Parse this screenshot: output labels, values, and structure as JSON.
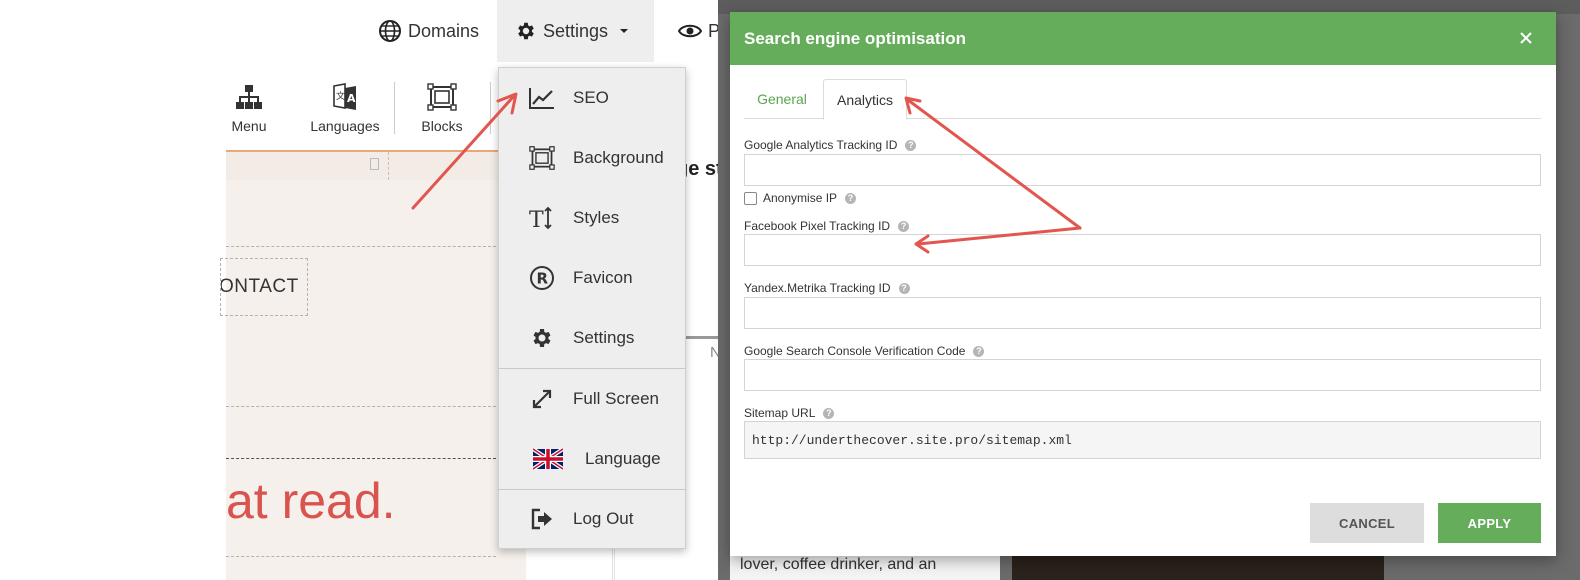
{
  "topnav": {
    "domains_label": "Domains",
    "settings_label": "Settings",
    "preview_label": "Pr"
  },
  "toolbar": {
    "menu_label": "Menu",
    "languages_label": "Languages",
    "blocks_label": "Blocks"
  },
  "canvas": {
    "contact_text": "ONTACT",
    "heading_fragment": "at read.",
    "stub_title": "ge st",
    "stub_n": "N"
  },
  "dropdown": {
    "items": [
      {
        "label": "SEO",
        "icon": "chart-line-icon"
      },
      {
        "label": "Background",
        "icon": "background-icon"
      },
      {
        "label": "Styles",
        "icon": "text-styles-icon"
      },
      {
        "label": "Favicon",
        "icon": "registered-icon"
      },
      {
        "label": "Settings",
        "icon": "gear-icon"
      },
      {
        "label": "Full Screen",
        "icon": "expand-icon"
      },
      {
        "label": "Language",
        "icon": "uk-flag-icon"
      },
      {
        "label": "Log Out",
        "icon": "logout-icon"
      }
    ]
  },
  "backdrop": {
    "bottom_text": "lover, coffee drinker, and an"
  },
  "modal": {
    "title": "Search engine optimisation",
    "tabs": [
      {
        "label": "General",
        "active": false
      },
      {
        "label": "Analytics",
        "active": true
      }
    ],
    "fields": {
      "ga_label": "Google Analytics Tracking ID",
      "ga_value": "",
      "anonymise_label": "Anonymise IP",
      "anonymise_checked": false,
      "fb_label": "Facebook Pixel Tracking ID",
      "fb_value": "",
      "yandex_label": "Yandex.Metrika Tracking ID",
      "yandex_value": "",
      "gsc_label": "Google Search Console Verification Code",
      "gsc_value": "",
      "sitemap_label": "Sitemap URL",
      "sitemap_value": "http://underthecover.site.pro/sitemap.xml"
    },
    "cancel_label": "CANCEL",
    "apply_label": "APPLY"
  },
  "colors": {
    "accent_green": "#65ad5b",
    "annotation_red": "#e2564f",
    "heading_red": "#d9534f"
  }
}
